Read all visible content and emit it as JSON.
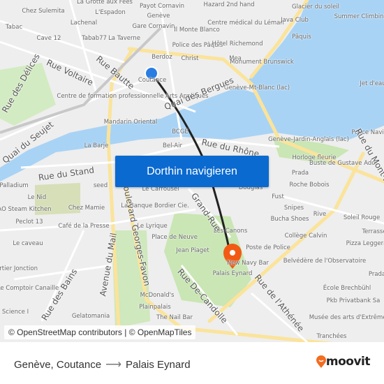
{
  "map": {
    "colors": {
      "water": "#a9d3f5",
      "park": "#c9e6b4",
      "road_major": "#fbe39a",
      "land": "#eeeeee",
      "route": "#222222",
      "origin": "#2a7de1",
      "destination": "#f25a14"
    },
    "labels": [
      "La Grotte aux Fées",
      "Payot Cornavin",
      "Chez Sulemita",
      "L'Espadon",
      "Genève",
      "Lachenal",
      "Tabac",
      "Gare Cornavin",
      "Cave 12",
      "Tabab77",
      "La Taverne",
      "Il Monte Blanco",
      "Police des Pâquis",
      "Berdoz",
      "Christ",
      "Coutance",
      "Centre de formation professionnelle Arts Appliqués",
      "Mandarin Oriental",
      "BCGE",
      "Bel-Air",
      "La Barje",
      "Hazard 2nd hand",
      "Centre médical du Léman",
      "Glacier du soleil",
      "Java Club",
      "Summer Climbing Wall",
      "Pâquis",
      "Hôtel Richemond",
      "Mea",
      "Monument Brunswick",
      "Genève-Mt-Blanc (lac)",
      "Jet d'eau",
      "Police Navigation",
      "Genève-Jardin-Anglais (lac)",
      "Horloge fleurie",
      "Buste de Gustave Ador",
      "Palladium",
      "seed",
      "Le Carrousel",
      "Le Nid",
      "AO Steam Kitchen",
      "Chez Mamie",
      "La Banque Bordier Cie.",
      "Peclot 13",
      "Café de la Presse",
      "Le Lyrique",
      "Place de Neuve",
      "Le caveau",
      "Jean Piaget",
      "Quartier Jonction",
      "Le Comptoir Canaille",
      "McDonald's",
      "Plainpalais",
      "Science I",
      "Gelatomania",
      "The Nail Bar",
      "Prada",
      "Roche Bobois",
      "Douglas",
      "Fust",
      "Snipes",
      "Rive",
      "Soleil Rouge",
      "Bucha Shoes",
      "Terrasse",
      "Les Canons",
      "Collège Calvin",
      "Pizza Leggera",
      "Poste de Police",
      "Belvédère de l'Observatoire",
      "New Navy Bar",
      "Palais Eynard",
      "École Brechbühl",
      "Pkb Privatbank Sa",
      "Musée des arts d'Extrême-Orient",
      "Tranchées",
      "Prada"
    ],
    "streets": [
      "Rue Voltaire",
      "Rue Bautte",
      "Rue des Délices",
      "Quai du Seujet",
      "Quai des Bergues",
      "Rue du Rhône",
      "Rue du Stand",
      "Boulevard Georges-Favon",
      "Avenue du Mail",
      "Grand-Rue",
      "Rue des Bains",
      "Rue De-Candolle",
      "Rue de l'Athénée",
      "Rue du Mont-Blanc"
    ],
    "origin_icon": "origin-dot-icon",
    "destination_icon": "destination-pin-icon"
  },
  "navigate_button": "Dorthin navigieren",
  "attribution": "© OpenStreetMap contributors | © OpenMapTiles",
  "route": {
    "from": "Genève, Coutance",
    "arrow_icon": "arrow-right-icon",
    "to": "Palais Eynard"
  },
  "brand": {
    "name": "moovit",
    "color": "#f26d21"
  }
}
